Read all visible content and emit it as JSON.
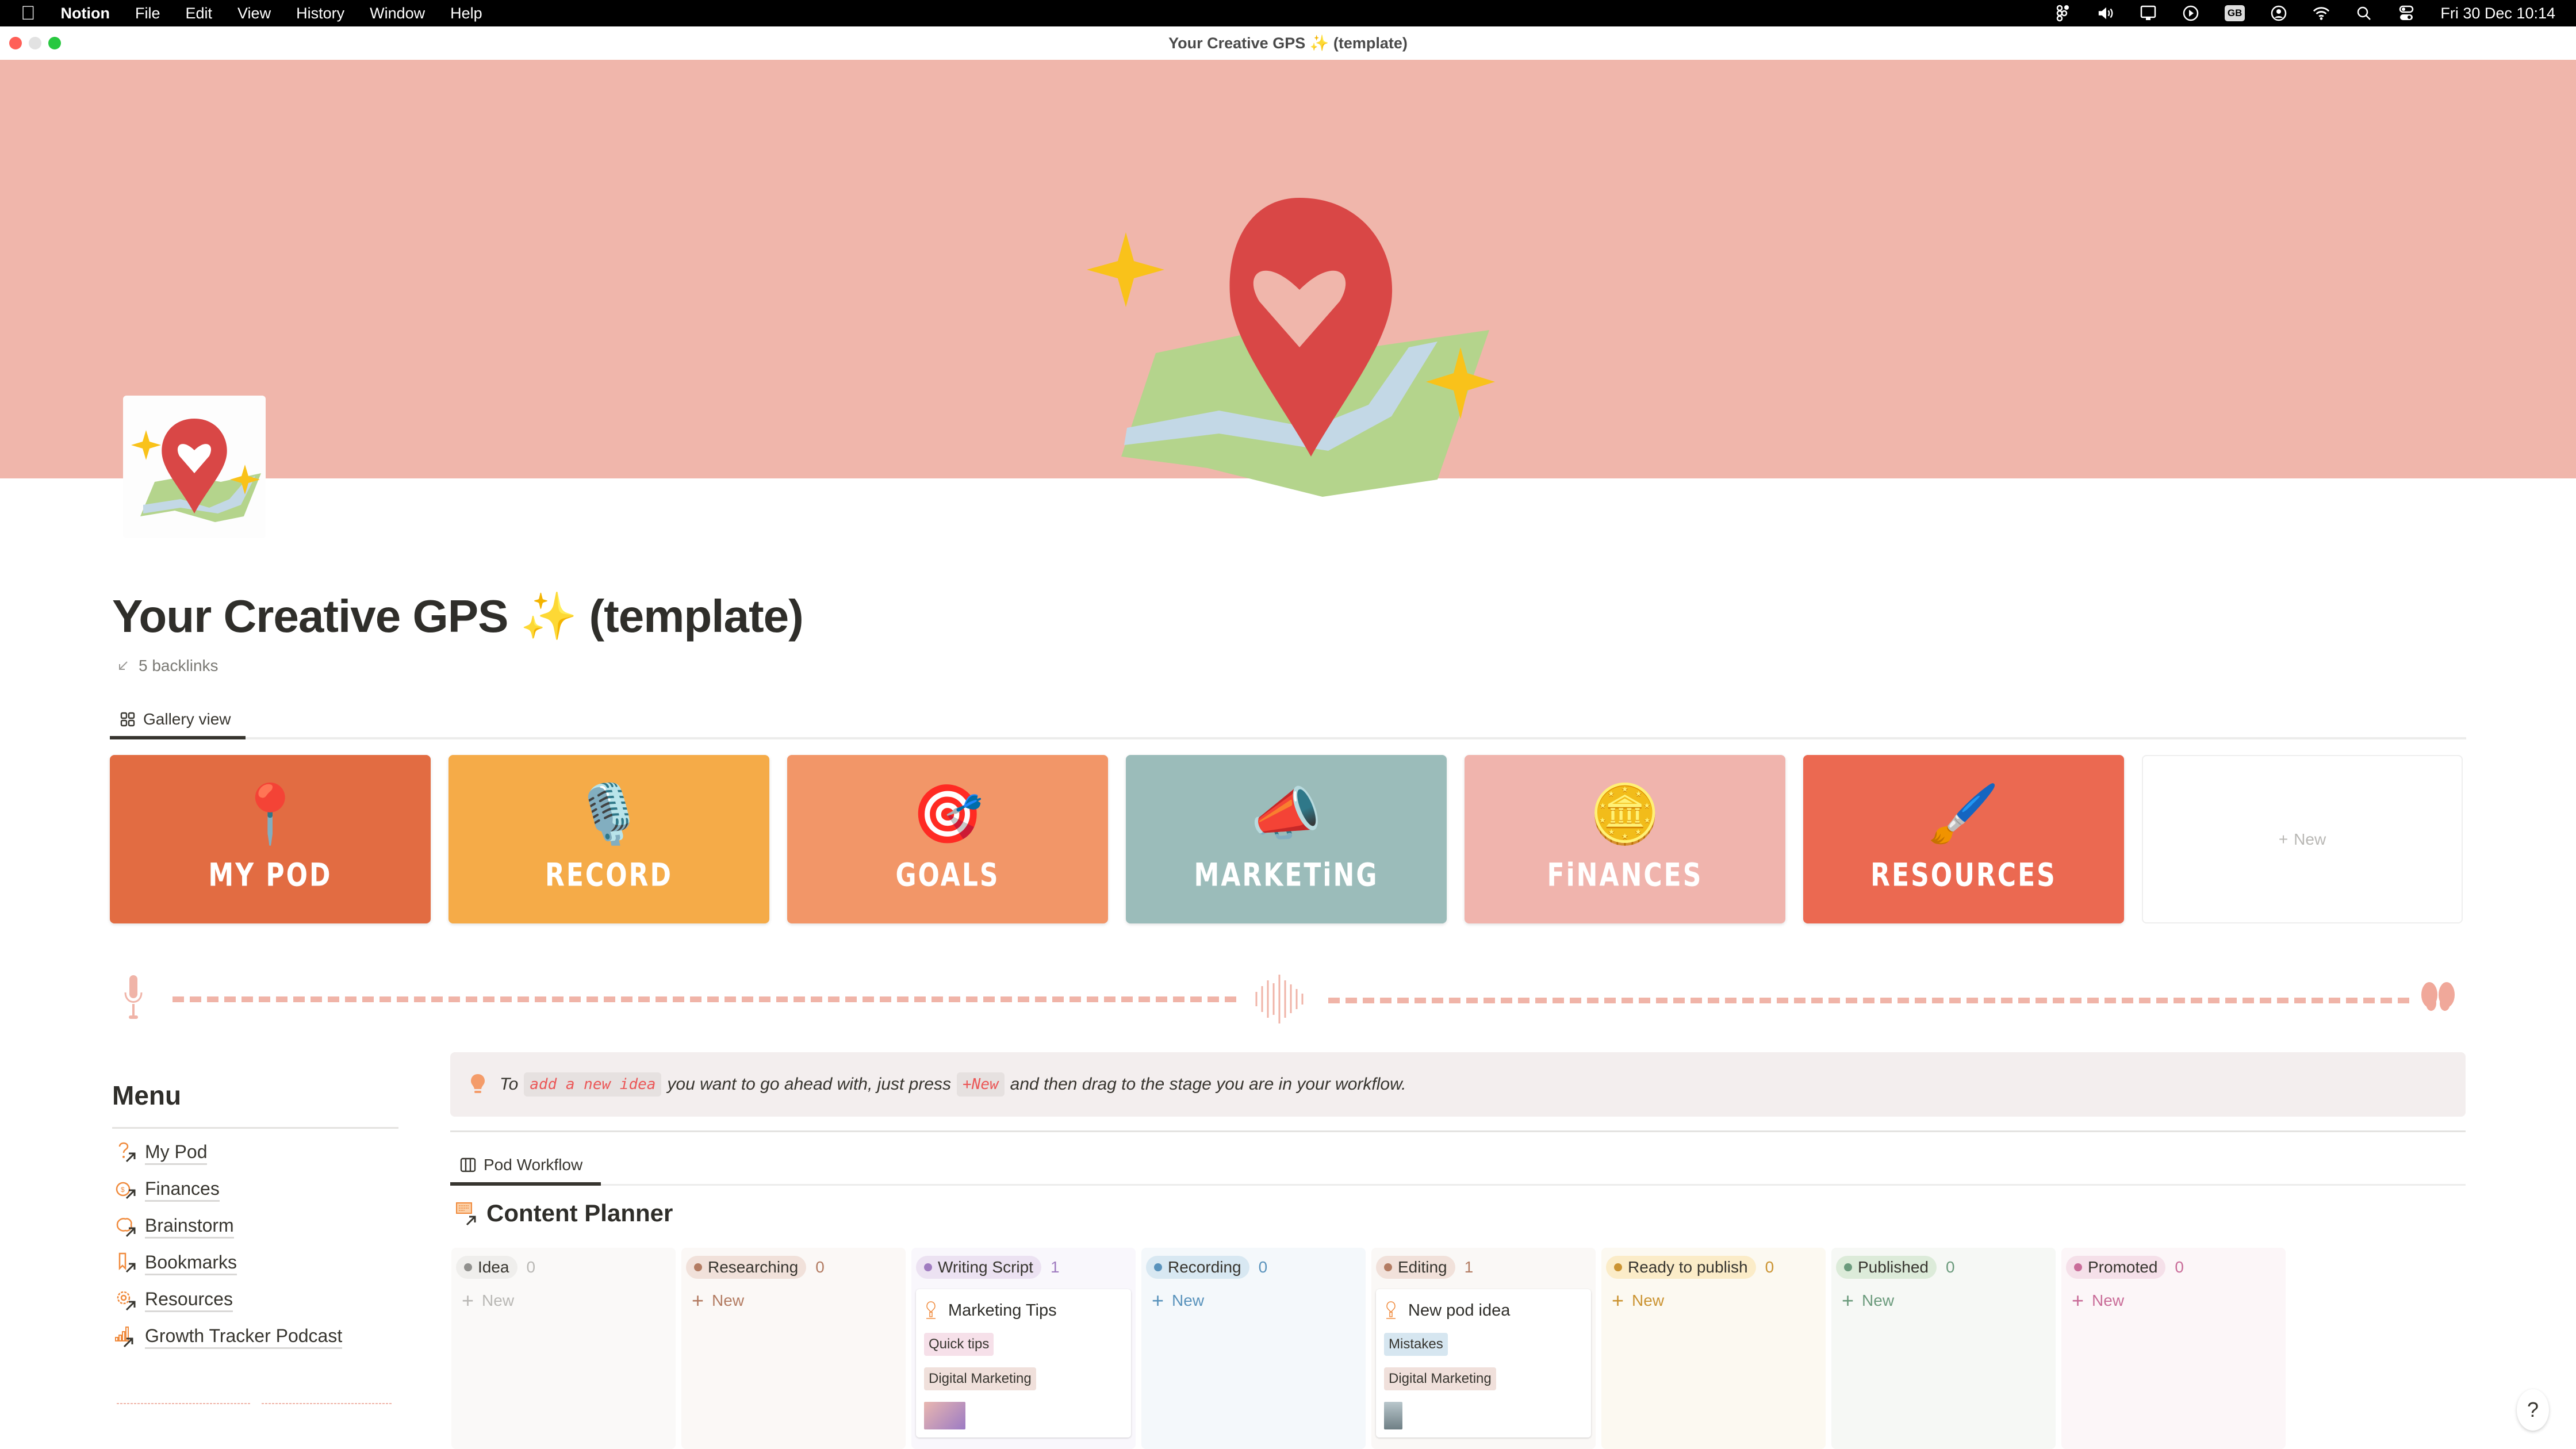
{
  "menubar": {
    "apple_icon": "apple-icon",
    "app_name": "Notion",
    "menus": [
      "File",
      "Edit",
      "View",
      "History",
      "Window",
      "Help"
    ],
    "status_icons": [
      "figma-icon",
      "volume-icon",
      "display-icon",
      "play-icon",
      "input-source-gb",
      "user-icon",
      "wifi-icon",
      "search-icon",
      "control-center-icon"
    ],
    "input_source": "GB",
    "datetime": "Fri 30 Dec  10:14"
  },
  "window": {
    "title": "Your Creative GPS ✨ (template)"
  },
  "page": {
    "title": "Your Creative GPS ✨ (template)",
    "backlinks": "5 backlinks",
    "cover_color": "#f0b6ab",
    "cover_art": "heart-location-pin-on-map-with-sparkles"
  },
  "gallery": {
    "tab_label": "Gallery view",
    "cards": [
      {
        "label": "MY POD",
        "color": "#e26c42",
        "icon": "📍"
      },
      {
        "label": "RECORD",
        "color": "#f5ab48",
        "icon": "🎙️"
      },
      {
        "label": "GOALS",
        "color": "#f29668",
        "icon": "🎯"
      },
      {
        "label": "MARKETiNG",
        "color": "#9bbcba",
        "icon": "📣"
      },
      {
        "label": "FiNANCES",
        "color": "#f0b4ad",
        "icon": "🪙"
      },
      {
        "label": "RESOURCES",
        "color": "#eb6951",
        "icon": "🖌️"
      }
    ],
    "new_label": "New"
  },
  "menu": {
    "title": "Menu",
    "items": [
      {
        "label": "My Pod",
        "icon": "question-mark-icon"
      },
      {
        "label": "Finances",
        "icon": "money-bag-icon"
      },
      {
        "label": "Brainstorm",
        "icon": "brain-icon"
      },
      {
        "label": "Bookmarks",
        "icon": "bookmark-icon"
      },
      {
        "label": "Resources",
        "icon": "gear-icon"
      },
      {
        "label": "Growth Tracker Podcast",
        "icon": "bar-chart-icon"
      }
    ]
  },
  "callout": {
    "text_1": "To",
    "code_1": "add a new idea",
    "text_2": "you want to go ahead with, just press",
    "code_2": "+New",
    "text_3": "and then drag to the stage you are in your workflow."
  },
  "workflow": {
    "tab_label": "Pod Workflow",
    "database_title": "Content Planner",
    "new_label": "New",
    "columns": [
      {
        "name": "Idea",
        "count": "0",
        "bg": "#faf9f8",
        "pill_bg": "#efeeec",
        "dot": "#91918e",
        "count_color": "#b9b8b5",
        "new_color": "#b9b8b5",
        "cards": []
      },
      {
        "name": "Researching",
        "count": "0",
        "bg": "#fbf8f6",
        "pill_bg": "#f1e1da",
        "dot": "#b37c63",
        "count_color": "#b37c63",
        "new_color": "#b37c63",
        "cards": []
      },
      {
        "name": "Writing Script",
        "count": "1",
        "bg": "#f9f7fc",
        "pill_bg": "#ece2f2",
        "dot": "#a07cc0",
        "count_color": "#a07cc0",
        "new_color": "#a07cc0",
        "cards": [
          {
            "title": "Marketing Tips",
            "tags": [
              {
                "label": "Quick tips",
                "bg": "#f6e0e9"
              },
              {
                "label": "Digital Marketing",
                "bg": "#f0e0db"
              }
            ],
            "thumb": "microphone-photo"
          }
        ]
      },
      {
        "name": "Recording",
        "count": "0",
        "bg": "#f4f8fb",
        "pill_bg": "#d8e8f2",
        "dot": "#5a93bc",
        "count_color": "#5a93bc",
        "new_color": "#5a93bc",
        "cards": []
      },
      {
        "name": "Editing",
        "count": "1",
        "bg": "#faf8f6",
        "pill_bg": "#f1e1da",
        "dot": "#b37c63",
        "count_color": "#b37c63",
        "new_color": "#b37c63",
        "cards": [
          {
            "title": "New pod idea",
            "tags": [
              {
                "label": "Mistakes",
                "bg": "#d6e6f0"
              },
              {
                "label": "Digital Marketing",
                "bg": "#f0e0db"
              }
            ],
            "thumb": "building-photo"
          }
        ]
      },
      {
        "name": "Ready to publish",
        "count": "0",
        "bg": "#fcf9f1",
        "pill_bg": "#fbecc8",
        "dot": "#cb9433",
        "count_color": "#cb9433",
        "new_color": "#cb9433",
        "cards": []
      },
      {
        "name": "Published",
        "count": "0",
        "bg": "#f6f8f5",
        "pill_bg": "#dcebd9",
        "dot": "#6c9b7d",
        "count_color": "#6c9b7d",
        "new_color": "#6c9b7d",
        "cards": []
      },
      {
        "name": "Promoted",
        "count": "0",
        "bg": "#fcf6f8",
        "pill_bg": "#f5e0e9",
        "dot": "#c96d99",
        "count_color": "#c96d99",
        "new_color": "#c96d99",
        "cards": []
      }
    ]
  },
  "help_label": "?"
}
